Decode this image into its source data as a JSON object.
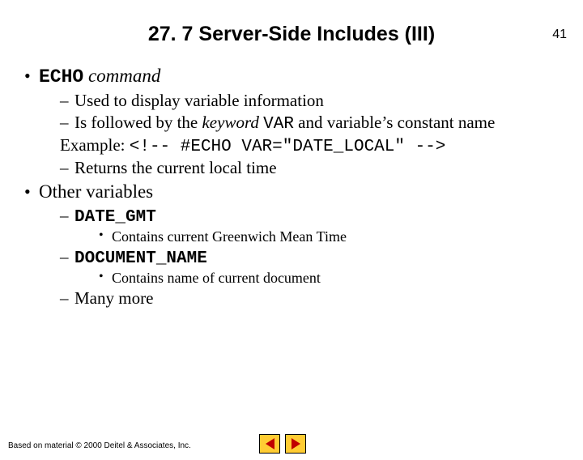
{
  "pageNumber": "41",
  "title": "27. 7 Server-Side Includes (III)",
  "bullets": {
    "b1": {
      "cmd": "ECHO",
      "rest": " command",
      "s1": "Used to display variable information",
      "s2a": "Is followed by the ",
      "s2kw": "keyword ",
      "s2var": "VAR",
      "s2b": " and variable’s constant name",
      "exLabel": "Example: ",
      "exCode": "<!-- #ECHO VAR=\"DATE_LOCAL\" -->",
      "s3": "Returns the current local time"
    },
    "b2": {
      "label": "Other variables",
      "v1": "DATE_GMT",
      "v1desc": "Contains current Greenwich Mean Time",
      "v2": "DOCUMENT_NAME",
      "v2desc": "Contains name of current document",
      "more": "Many more"
    }
  },
  "footer": "Based on material © 2000 Deitel & Associates, Inc."
}
